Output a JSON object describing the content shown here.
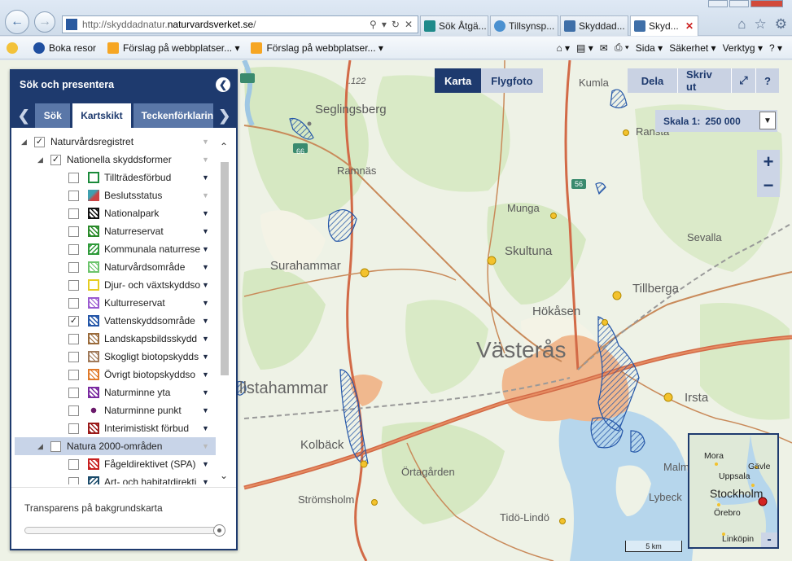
{
  "browser": {
    "address_prefix": "http://skyddadnatur.",
    "address_domain": "naturvardsverket.se",
    "address_suffix": "/",
    "tabs": [
      {
        "label": "Sök Åtgä...",
        "active": false
      },
      {
        "label": "Tillsynsp...",
        "active": false
      },
      {
        "label": "Skyddad...",
        "active": false
      },
      {
        "label": "Skyd...",
        "active": true
      }
    ],
    "favorites": [
      {
        "label": "Boka resor"
      },
      {
        "label": "Förslag på webbplatser..."
      },
      {
        "label": "Förslag på webbplatser..."
      }
    ],
    "commands": {
      "sida": "Sida",
      "sakerhet": "Säkerhet",
      "verktyg": "Verktyg"
    }
  },
  "panel": {
    "title": "Sök och presentera",
    "tabs": [
      "Sök",
      "Kartskikt",
      "Teckenförklarin"
    ],
    "active_tab": "Kartskikt",
    "layers": [
      {
        "label": "Naturvårdsregistret",
        "level": 0,
        "checked": true,
        "symbol": "none",
        "expanded": true
      },
      {
        "label": "Nationella skyddsformer",
        "level": 1,
        "checked": true,
        "symbol": "none",
        "expanded": true
      },
      {
        "label": "Tillträdesförbud",
        "level": 2,
        "checked": false,
        "symbol": "outline-green"
      },
      {
        "label": "Beslutsstatus",
        "level": 2,
        "checked": false,
        "symbol": "stack"
      },
      {
        "label": "Nationalpark",
        "level": 2,
        "checked": false,
        "symbol": "hatch-black"
      },
      {
        "label": "Naturreservat",
        "level": 2,
        "checked": false,
        "symbol": "hatch-green"
      },
      {
        "label": "Kommunala naturrese",
        "level": 2,
        "checked": false,
        "symbol": "hatch-green2"
      },
      {
        "label": "Naturvårdsområde",
        "level": 2,
        "checked": false,
        "symbol": "hatch-lightgreen"
      },
      {
        "label": "Djur- och växtskyddso",
        "level": 2,
        "checked": false,
        "symbol": "outline-yellow"
      },
      {
        "label": "Kulturreservat",
        "level": 2,
        "checked": false,
        "symbol": "hatch-purple"
      },
      {
        "label": "Vattenskyddsområde",
        "level": 2,
        "checked": true,
        "symbol": "hatch-blue"
      },
      {
        "label": "Landskapsbildsskydd",
        "level": 2,
        "checked": false,
        "symbol": "hatch-brown"
      },
      {
        "label": "Skogligt biotopskydds",
        "level": 2,
        "checked": false,
        "symbol": "hatch-brown2"
      },
      {
        "label": "Övrigt biotopskyddso",
        "level": 2,
        "checked": false,
        "symbol": "hatch-orange"
      },
      {
        "label": "Naturminne yta",
        "level": 2,
        "checked": false,
        "symbol": "hatch-purple2"
      },
      {
        "label": "Naturminne punkt",
        "level": 2,
        "checked": false,
        "symbol": "dot"
      },
      {
        "label": "Interimistiskt förbud",
        "level": 2,
        "checked": false,
        "symbol": "hatch-darkred"
      },
      {
        "label": "Natura 2000-områden",
        "level": 1,
        "checked": false,
        "symbol": "none",
        "expanded": true,
        "highlight": true
      },
      {
        "label": "Fågeldirektivet (SPA)",
        "level": 2,
        "checked": false,
        "symbol": "hatch-red"
      },
      {
        "label": "Art- och habitatdirekti",
        "level": 2,
        "checked": false,
        "symbol": "hatch-teal"
      }
    ],
    "transparency_label": "Transparens på bakgrundskarta",
    "transparency_value": 1.0
  },
  "map": {
    "buttons": {
      "karta": "Karta",
      "flygfoto": "Flygfoto",
      "dela": "Dela",
      "skriv_ut": "Skriv ut",
      "help": "?"
    },
    "scale_label": "Skala 1:",
    "scale_value": "250 000",
    "zoom_in": "+",
    "zoom_out": "−",
    "places": [
      "Seglingsberg",
      "Ramnäs",
      "Surahammar",
      "Kolbäck",
      "Strömsholm",
      "Örtagården",
      "Västerås",
      "Hökåsen",
      "Skultuna",
      "Munga",
      "Tillberga",
      "Irsta",
      "Sevalla",
      "Kumla",
      "Ranstа",
      "Tidö-Lindö",
      "Malm",
      "Lybeck",
      "llstahammar"
    ],
    "elevation": ".122",
    "roads": [
      "66",
      "66",
      "56"
    ],
    "scalebar": "5 km",
    "overview": {
      "places": [
        "Mora",
        "Gävle",
        "Uppsala",
        "Stockholm",
        "Örebro",
        "Linköpin"
      ],
      "minimize": "-"
    }
  }
}
